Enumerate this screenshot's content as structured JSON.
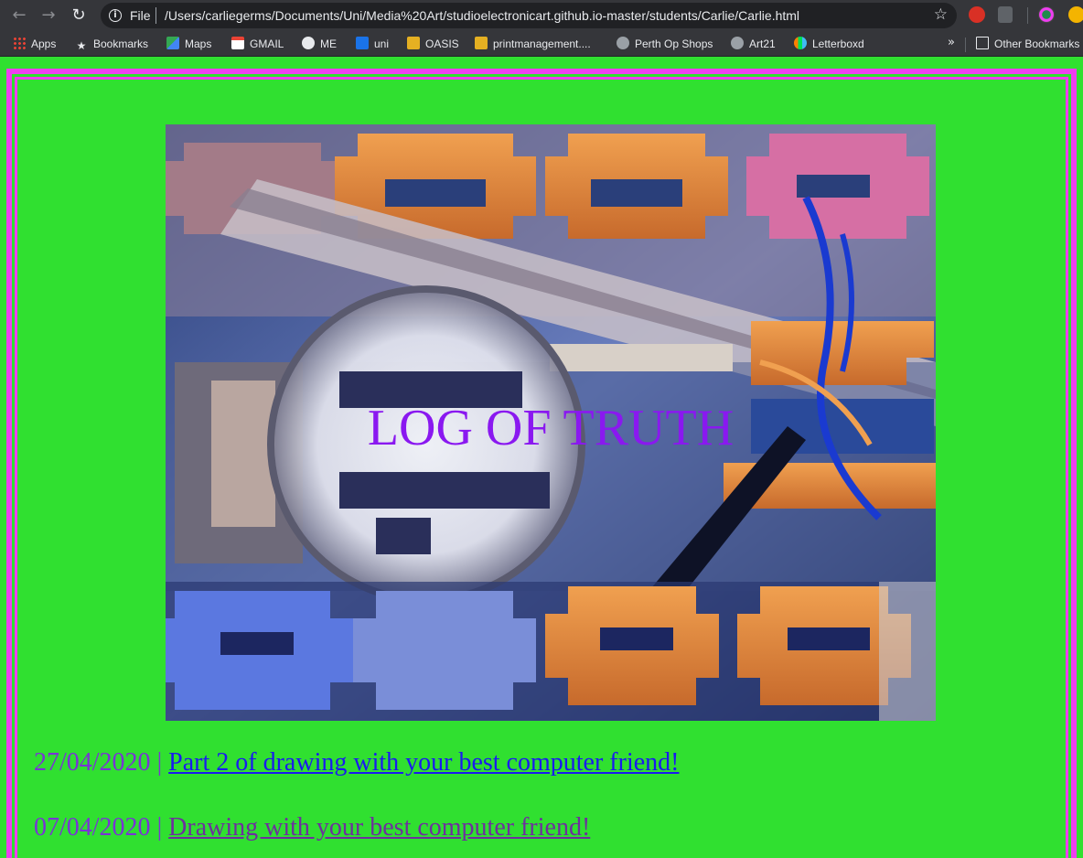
{
  "browser": {
    "scheme_label": "File",
    "url": "/Users/carliegerms/Documents/Uni/Media%20Art/studioelectronicart.github.io-master/students/Carlie/Carlie.html"
  },
  "bookmarks": {
    "items": [
      {
        "label": "Apps",
        "icon": "apps-grid-icon"
      },
      {
        "label": "Bookmarks",
        "icon": "star-icon"
      },
      {
        "label": "Maps",
        "icon": "maps-icon"
      },
      {
        "label": "GMAIL",
        "icon": "gmail-icon"
      },
      {
        "label": "ME",
        "icon": "me-icon"
      },
      {
        "label": "uni",
        "icon": "outlook-icon"
      },
      {
        "label": "OASIS",
        "icon": "oasis-icon"
      },
      {
        "label": "printmanagement....",
        "icon": "print-icon"
      },
      {
        "label": "Perth Op Shops",
        "icon": "globe-icon"
      },
      {
        "label": "Art21",
        "icon": "globe-icon"
      },
      {
        "label": "Letterboxd",
        "icon": "letterboxd-icon"
      }
    ],
    "overflow": "»",
    "other_label": "Other Bookmarks"
  },
  "page": {
    "title": "LOG OF TRUTH",
    "colors": {
      "background": "#30e030",
      "frame": "#ee3ef0",
      "title": "#8a18f0",
      "date": "#7a33d6"
    },
    "entries": [
      {
        "date": "27/04/2020",
        "separator": "|",
        "link": "Part 2 of drawing with your best computer friend!",
        "visited": false
      },
      {
        "date": "07/04/2020",
        "separator": "|",
        "link": "Drawing with your best computer friend!",
        "visited": true
      }
    ]
  }
}
